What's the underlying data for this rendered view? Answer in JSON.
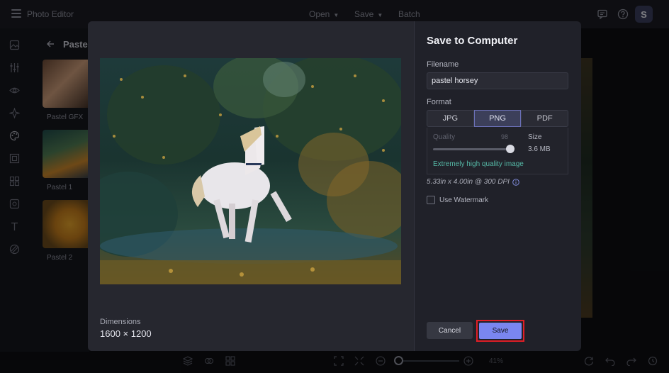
{
  "app": {
    "title": "Photo Editor",
    "menu": [
      {
        "label": "Open",
        "icon": "chevron-down-icon"
      },
      {
        "label": "Save",
        "icon": "chevron-down-icon"
      },
      {
        "label": "Batch"
      }
    ],
    "avatar_initial": "S",
    "zoom_percent": "41%"
  },
  "panel": {
    "title": "Pastel",
    "thumbnails": [
      {
        "label": "Pastel GFX"
      },
      {
        "label": "Pastel 1"
      },
      {
        "label": "Pastel 2"
      }
    ]
  },
  "dialog": {
    "title": "Save to Computer",
    "filename_label": "Filename",
    "filename_value": "pastel horsey",
    "format_label": "Format",
    "formats": [
      "JPG",
      "PNG",
      "PDF"
    ],
    "selected_format": "PNG",
    "quality_label": "Quality",
    "quality_value": "98",
    "quality_level": 0.98,
    "size_label": "Size",
    "size_value": "3.6 MB",
    "quality_note": "Extremely high quality image",
    "dpi_text": "5.33in x 4.00in @ 300 DPI",
    "watermark_label": "Use Watermark",
    "watermark_checked": false,
    "dimensions_label": "Dimensions",
    "dimensions_value": "1600 × 1200",
    "cancel_label": "Cancel",
    "save_label": "Save"
  },
  "colors": {
    "accent": "#7a86f0",
    "highlight": "#e01e26",
    "quality_note": "#55b8a6"
  }
}
